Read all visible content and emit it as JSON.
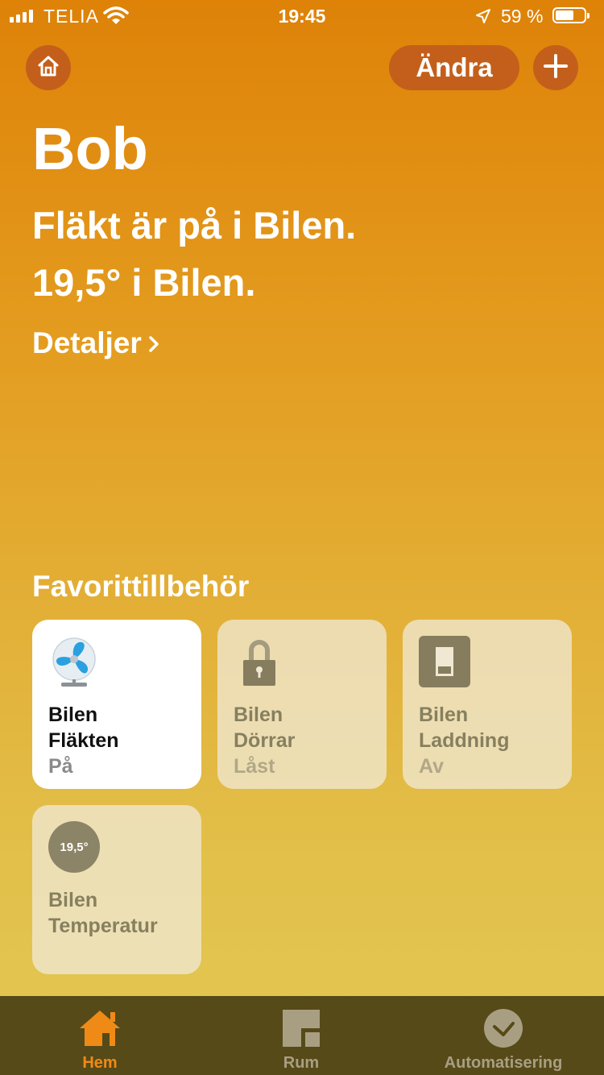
{
  "status_bar": {
    "carrier": "TELIA",
    "time": "19:45",
    "battery": "59 %"
  },
  "header": {
    "home_icon": "home-icon",
    "edit_label": "Ändra",
    "add_icon": "plus-icon"
  },
  "home": {
    "title": "Bob",
    "status_lines": [
      "Fläkt är på i Bilen.",
      "19,5° i Bilen."
    ],
    "details_label": "Detaljer"
  },
  "favorites": {
    "section_title": "Favorittillbehör",
    "tiles": [
      {
        "room": "Bilen",
        "name": "Fläkten",
        "state": "På",
        "icon": "fan-icon",
        "active": true
      },
      {
        "room": "Bilen",
        "name": "Dörrar",
        "state": "Låst",
        "icon": "lock-icon",
        "active": false
      },
      {
        "room": "Bilen",
        "name": "Laddning",
        "state": "Av",
        "icon": "switch-icon",
        "active": false
      },
      {
        "room": "Bilen",
        "name": "Temperatur",
        "state": "",
        "badge": "19,5°",
        "icon": "thermometer-badge",
        "active": false
      }
    ]
  },
  "tabbar": {
    "tabs": [
      {
        "label": "Hem",
        "icon": "home-tab-icon",
        "selected": true
      },
      {
        "label": "Rum",
        "icon": "rooms-tab-icon",
        "selected": false
      },
      {
        "label": "Automatisering",
        "icon": "automation-tab-icon",
        "selected": false
      }
    ]
  },
  "colors": {
    "accent": "#f08a16",
    "button_bg": "#c45f1b",
    "tabbar_bg": "#564a18"
  }
}
